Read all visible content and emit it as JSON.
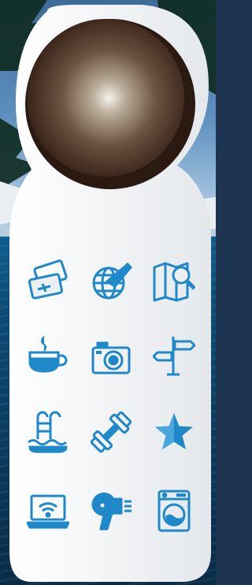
{
  "hanger": {
    "card_color": "#edf0f2",
    "icon_color": "#1f88c9",
    "knob_color": "#5a4030"
  },
  "icons": [
    {
      "name": "boarding-pass-icon"
    },
    {
      "name": "globe-plane-icon"
    },
    {
      "name": "map-search-icon"
    },
    {
      "name": "coffee-cup-icon"
    },
    {
      "name": "camera-icon"
    },
    {
      "name": "signpost-icon"
    },
    {
      "name": "swimming-pool-icon"
    },
    {
      "name": "dumbbell-icon"
    },
    {
      "name": "star-icon"
    },
    {
      "name": "laptop-wifi-icon"
    },
    {
      "name": "hair-dryer-icon"
    },
    {
      "name": "washing-machine-icon"
    }
  ]
}
